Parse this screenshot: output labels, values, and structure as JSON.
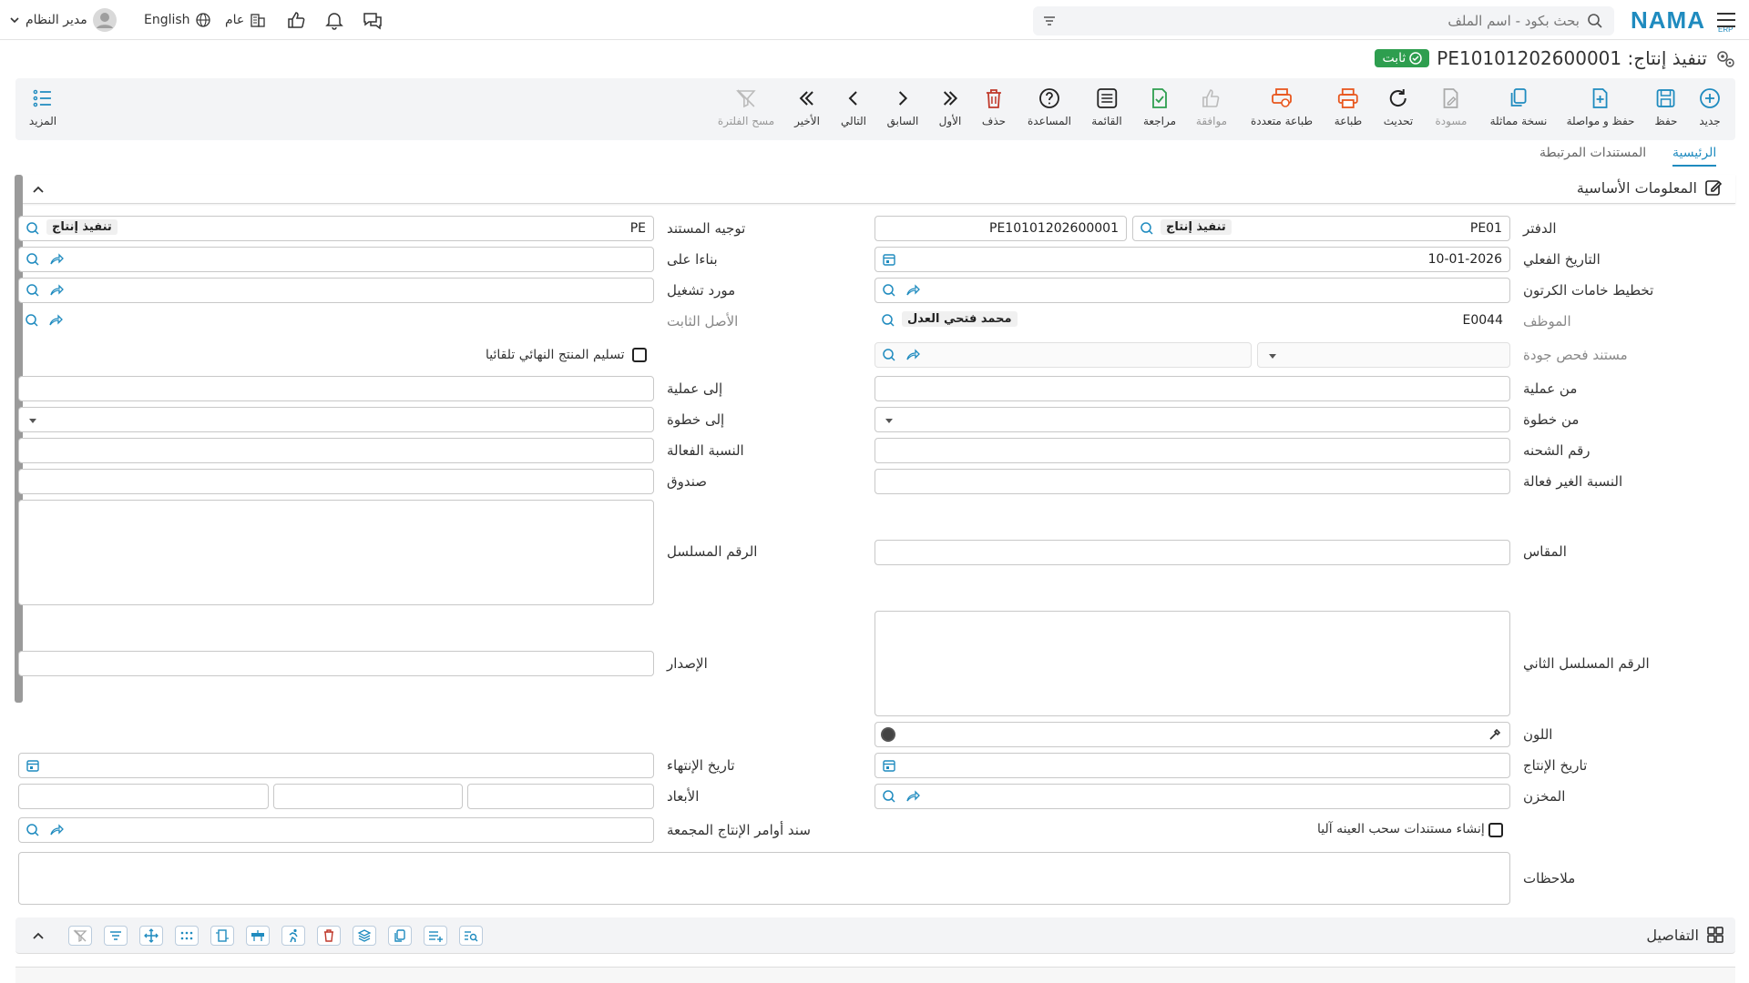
{
  "topbar": {
    "search_placeholder": "بحث بكود - اسم الملف",
    "logo_text": "NAMA",
    "logo_sub": "ERP",
    "user_name": "مدير النظام",
    "language": "English",
    "scope": "عام"
  },
  "header": {
    "title": "تنفيذ إنتاج: PE10101202600001",
    "status": "ثابت"
  },
  "toolbar": {
    "new": "جديد",
    "save": "حفظ",
    "save_continue": "حفظ و مواصلة",
    "copy": "نسخة مماثلة",
    "draft": "مسودة",
    "refresh": "تحديث",
    "print": "طباعة",
    "multi_print": "طباعة متعددة",
    "approve": "موافقة",
    "review": "مراجعة",
    "list": "القائمة",
    "help": "المساعدة",
    "delete": "حذف",
    "first": "الأول",
    "previous": "السابق",
    "next": "التالي",
    "last": "الأخير",
    "clear_filter": "مسح الفلترة",
    "more": "المزيد"
  },
  "tabs": {
    "main": "الرئيسية",
    "related": "المستندات المرتبطة"
  },
  "section": {
    "basic_info": "المعلومات الأساسية",
    "details": "التفاصيل"
  },
  "form": {
    "book_label": "الدفتر",
    "book_code": "PE01",
    "book_tag": "تنفيذ إنتاج",
    "doc_number": "PE10101202600001",
    "doc_direction_label": "توجيه المستند",
    "doc_direction_code": "PE",
    "doc_direction_tag": "تنفيذ إنتاج",
    "actual_date_label": "التاريخ الفعلي",
    "actual_date": "10-01-2026",
    "based_on_label": "بناءا على",
    "carton_planning_label": "تخطيط خامات الكرتون",
    "operation_supplier_label": "مورد تشغيل",
    "employee_label": "الموظف",
    "employee_code": "E0044",
    "employee_name": "محمد فتحي العدل",
    "fixed_asset_label": "الأصل الثابت",
    "quality_doc_label": "مستند فحص جودة",
    "auto_deliver_label": "تسليم المنتج النهائي تلقائيا",
    "from_operation_label": "من عملية",
    "to_operation_label": "إلى عملية",
    "from_step_label": "من خطوة",
    "to_step_label": "إلى خطوة",
    "batch_label": "رقم الشحنه",
    "effective_ratio_label": "النسبة الفعالة",
    "ineffective_ratio_label": "النسبة الغير فعالة",
    "box_label": "صندوق",
    "size_label": "المقاس",
    "serial_label": "الرقم المسلسل",
    "serial2_label": "الرقم المسلسل الثاني",
    "version_label": "الإصدار",
    "color_label": "اللون",
    "production_date_label": "تاريخ الإنتاج",
    "end_date_label": "تاريخ الإنتهاء",
    "warehouse_label": "المخزن",
    "dimensions_label": "الأبعاد",
    "auto_sample_label": "إنشاء مستندات سحب العينه آليا",
    "aggregated_orders_label": "سند أوامر الإنتاج المجمعة",
    "notes_label": "ملاحظات"
  }
}
